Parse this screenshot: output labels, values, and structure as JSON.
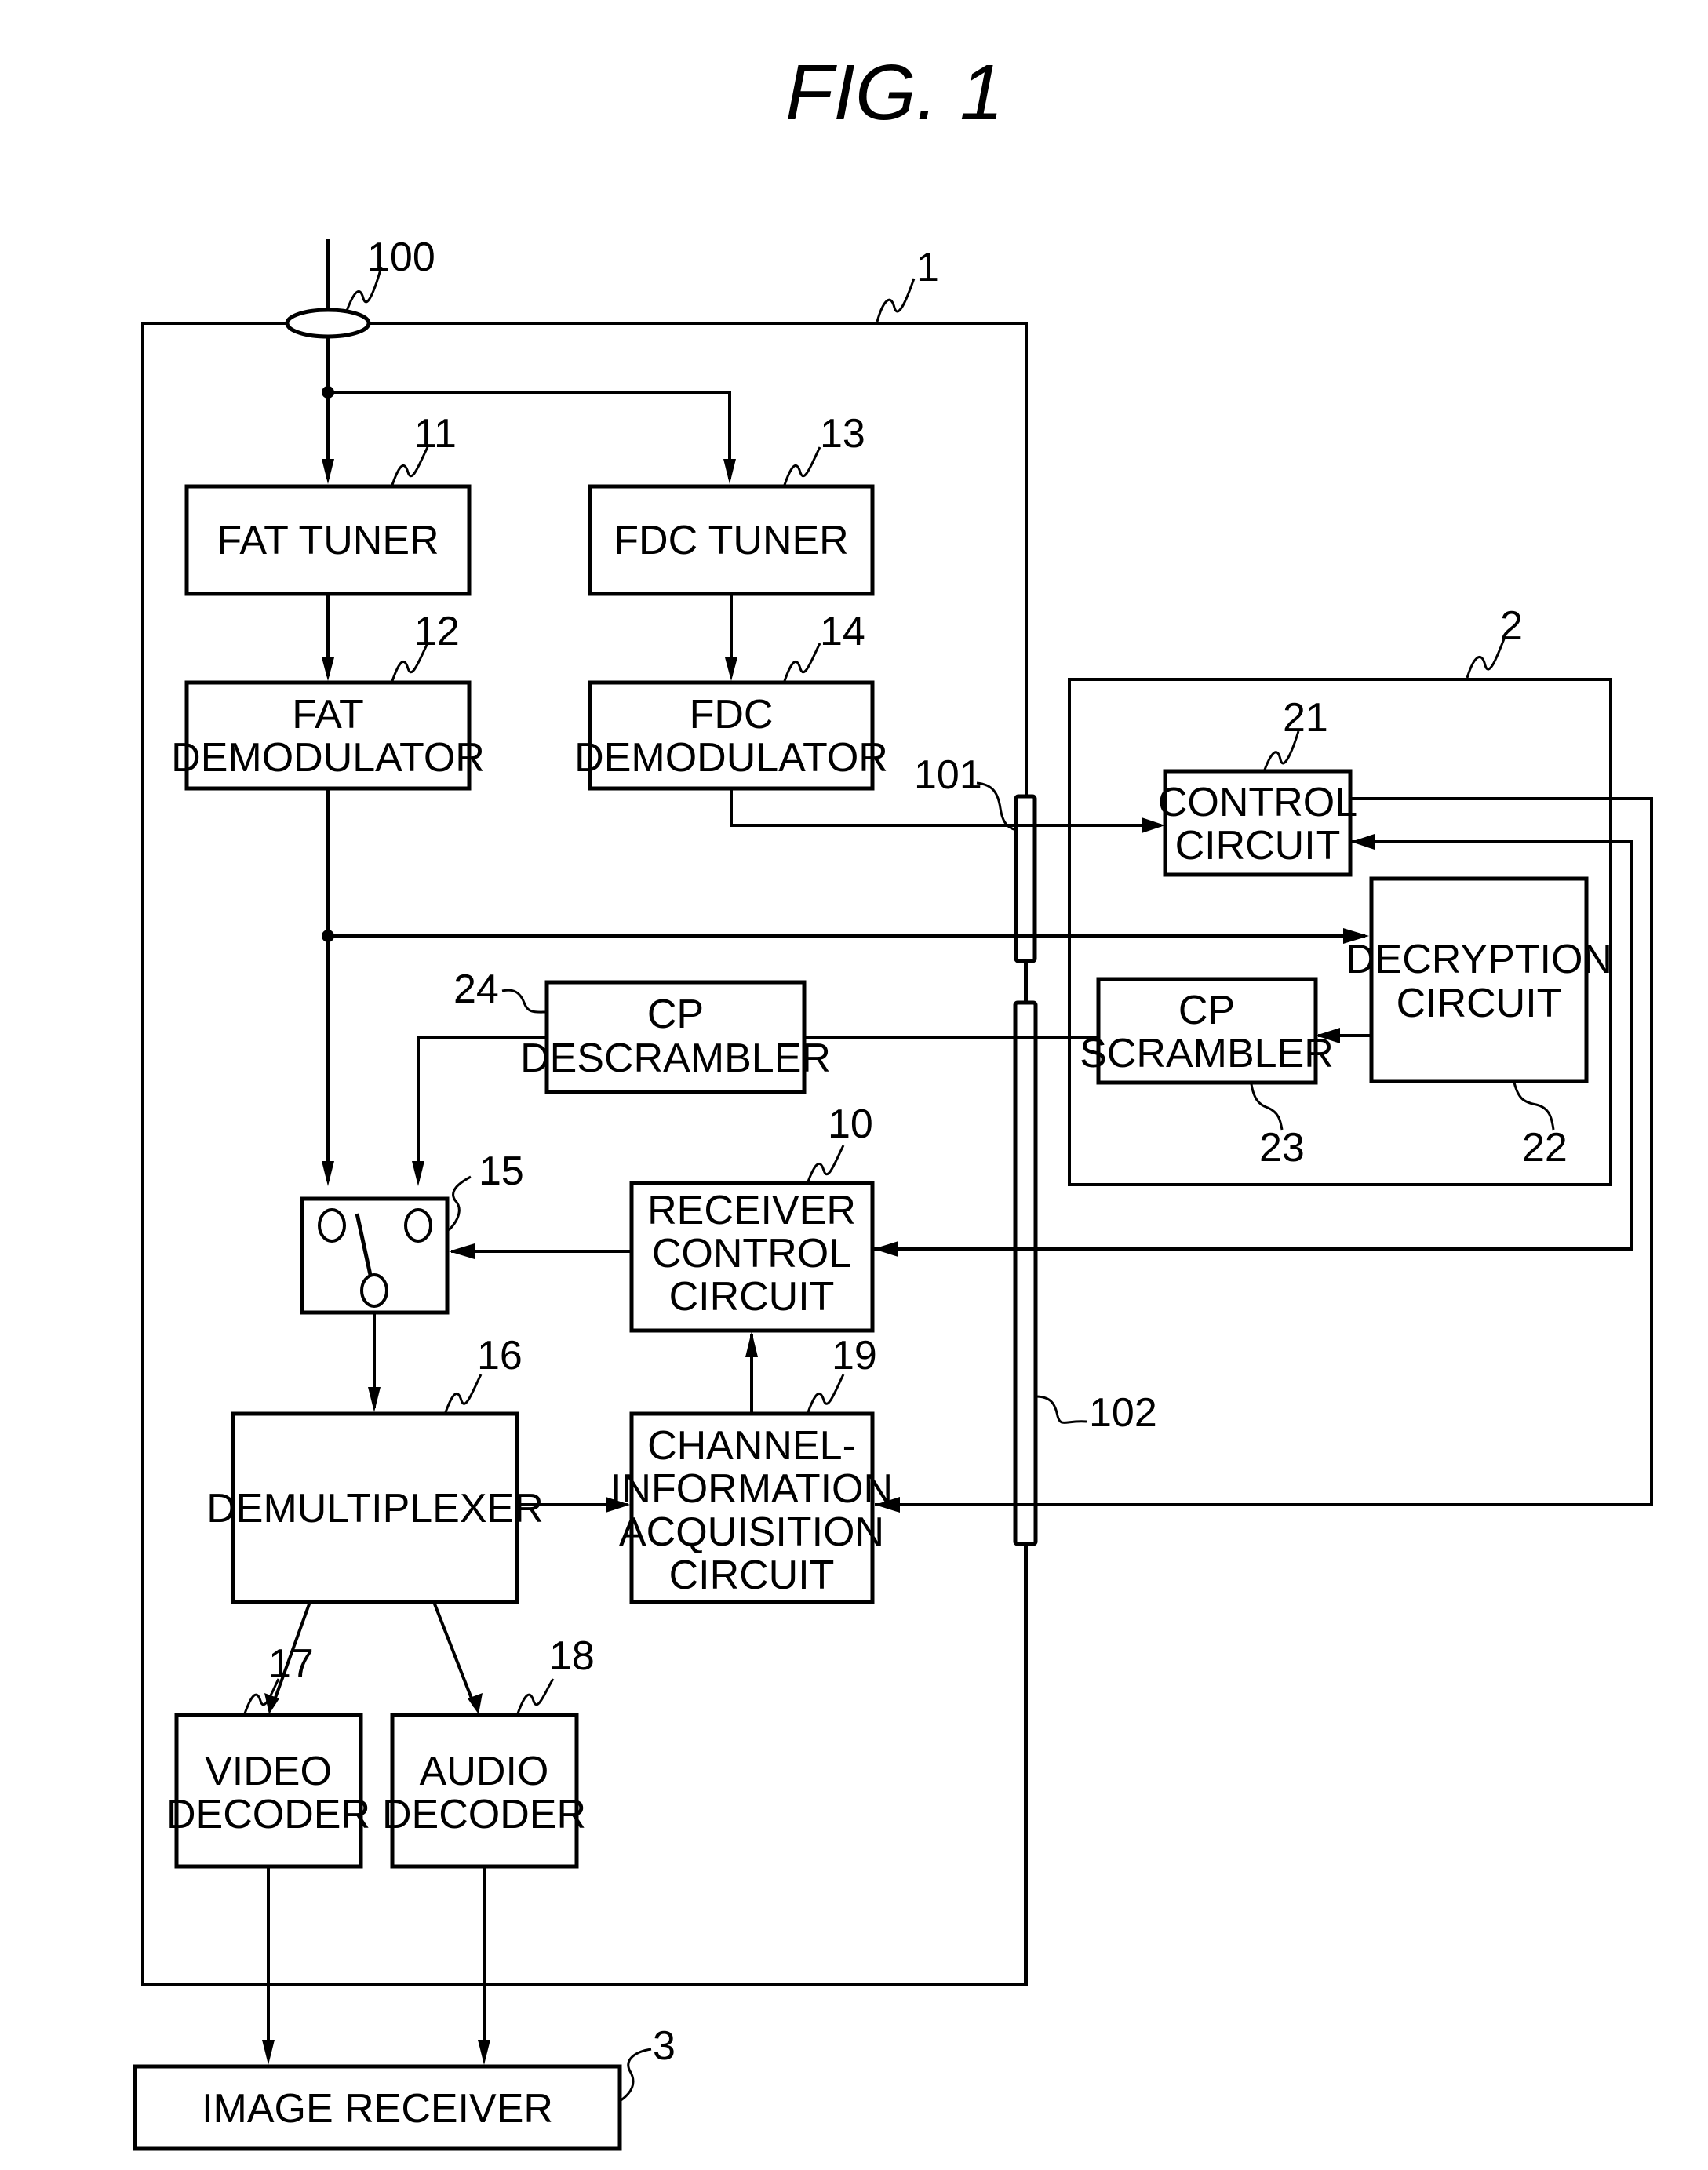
{
  "figure": {
    "title": "FIG.  1"
  },
  "containers": {
    "receiver": {
      "ref": "1"
    },
    "module": {
      "ref": "2"
    }
  },
  "blocks": {
    "fat_tuner": {
      "ref": "11",
      "lines": [
        "FAT TUNER"
      ]
    },
    "fdc_tuner": {
      "ref": "13",
      "lines": [
        "FDC TUNER"
      ]
    },
    "fat_demod": {
      "ref": "12",
      "lines": [
        "FAT",
        "DEMODULATOR"
      ]
    },
    "fdc_demod": {
      "ref": "14",
      "lines": [
        "FDC",
        "DEMODULATOR"
      ]
    },
    "control_circuit": {
      "ref": "21",
      "lines": [
        "CONTROL",
        "CIRCUIT"
      ]
    },
    "decryption_circuit": {
      "ref": "22",
      "lines": [
        "DECRYPTION",
        "CIRCUIT"
      ]
    },
    "cp_scrambler": {
      "ref": "23",
      "lines": [
        "CP",
        "SCRAMBLER"
      ]
    },
    "cp_descrambler": {
      "ref": "24",
      "lines": [
        "CP",
        "DESCRAMBLER"
      ]
    },
    "switch": {
      "ref": "15"
    },
    "receiver_control": {
      "ref": "10",
      "lines": [
        "RECEIVER",
        "CONTROL",
        "CIRCUIT"
      ]
    },
    "demultiplexer": {
      "ref": "16",
      "lines": [
        "DEMULTIPLEXER"
      ]
    },
    "channel_info": {
      "ref": "19",
      "lines": [
        "CHANNEL-",
        "INFORMATION",
        "ACQUISITION",
        "CIRCUIT"
      ]
    },
    "video_decoder": {
      "ref": "17",
      "lines": [
        "VIDEO",
        "DECODER"
      ]
    },
    "audio_decoder": {
      "ref": "18",
      "lines": [
        "AUDIO",
        "DECODER"
      ]
    },
    "image_receiver": {
      "ref": "3",
      "lines": [
        "IMAGE RECEIVER"
      ]
    }
  },
  "connectors": {
    "input_terminal": {
      "ref": "100"
    },
    "bus_101": {
      "ref": "101"
    },
    "bus_102": {
      "ref": "102"
    }
  }
}
